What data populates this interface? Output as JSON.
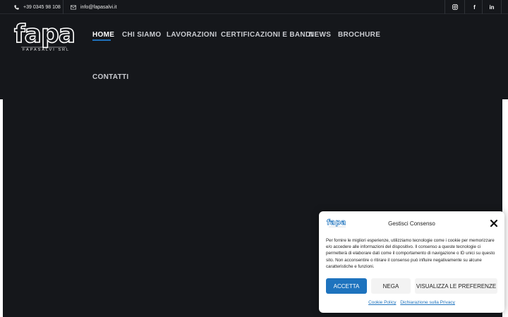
{
  "topbar": {
    "phone": "+39 0345 98 108",
    "email": "info@fapasalvi.it",
    "social": [
      {
        "icon": "instagram-icon",
        "label": ""
      },
      {
        "icon": "facebook-icon",
        "label": "f"
      },
      {
        "icon": "linkedin-icon",
        "label": "in"
      }
    ]
  },
  "header": {
    "logo_text": "fapa",
    "logo_subtitle": "FAPASALVI SRL",
    "nav": [
      {
        "label": "HOME",
        "active": true
      },
      {
        "label": "CHI SIAMO"
      },
      {
        "label": "LAVORAZIONI"
      },
      {
        "label": "CERTIFICAZIONI E BANDI"
      },
      {
        "label": "NEWS"
      },
      {
        "label": "BROCHURE"
      },
      {
        "label": "CONTATTI"
      }
    ]
  },
  "cookie": {
    "title": "Gestisci Consenso",
    "text": "Per fornire le migliori esperienze, utilizziamo tecnologie come i cookie per memorizzare e/o accedere alle informazioni del dispositivo. Il consenso a queste tecnologie ci permetterà di elaborare dati come il comportamento di navigazione o ID unici su questo sito. Non acconsentire o ritirare il consenso può influire negativamente su alcune caratteristiche e funzioni.",
    "accept": "ACCETTA",
    "deny": "NEGA",
    "preferences": "VISUALIZZA LE PREFERENZE",
    "links": [
      "Cookie Policy",
      "Dichiarazione sulla Privacy"
    ]
  },
  "colors": {
    "dark": "#15171b",
    "accent": "#1e73be",
    "white": "#ffffff"
  }
}
